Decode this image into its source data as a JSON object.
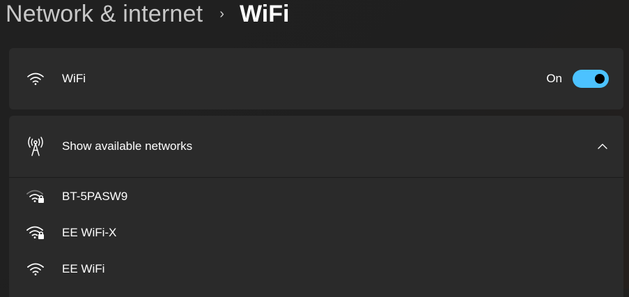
{
  "breadcrumb": {
    "parent": "Network & internet",
    "separator": "›",
    "current": "WiFi"
  },
  "wifi_toggle": {
    "label": "WiFi",
    "state_text": "On",
    "enabled": true,
    "icon": "wifi-icon"
  },
  "available_networks": {
    "label": "Show available networks",
    "icon": "antenna-icon",
    "expanded": true,
    "chevron_icon": "chevron-up-icon",
    "items": [
      {
        "name": "BT-5PASW9",
        "secured": true,
        "icon": "wifi-lock-icon"
      },
      {
        "name": "EE WiFi-X",
        "secured": true,
        "icon": "wifi-lock-icon"
      },
      {
        "name": "EE WiFi",
        "secured": false,
        "icon": "wifi-icon"
      }
    ]
  },
  "colors": {
    "accent": "#4cc2ff",
    "card": "#2b2b2b",
    "background": "#202020"
  }
}
